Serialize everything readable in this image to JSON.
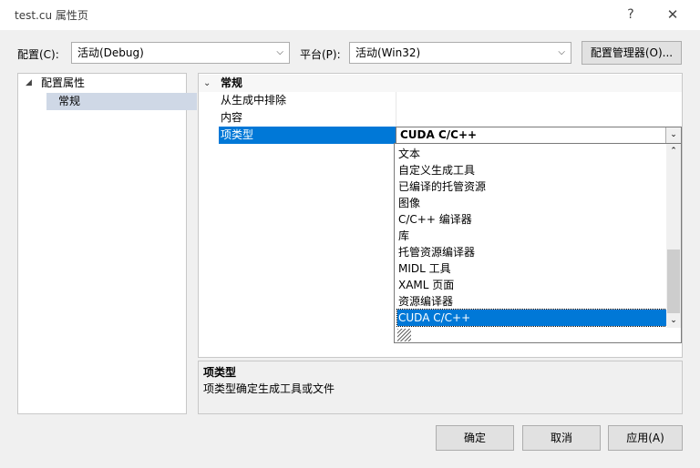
{
  "window": {
    "title": "test.cu 属性页",
    "help_glyph": "?",
    "close_glyph": "✕"
  },
  "toolbar": {
    "config_label": "配置(C):",
    "config_value": "活动(Debug)",
    "platform_label": "平台(P):",
    "platform_value": "活动(Win32)",
    "config_manager_label": "配置管理器(O)..."
  },
  "tree": {
    "root": {
      "label": "配置属性",
      "expanded": true
    },
    "children": [
      {
        "label": "常规",
        "selected": true
      }
    ]
  },
  "grid": {
    "category": "常规",
    "rows": [
      {
        "name": "从生成中排除",
        "value": ""
      },
      {
        "name": "内容",
        "value": ""
      },
      {
        "name": "项类型",
        "value": "CUDA C/C++",
        "selected": true
      }
    ]
  },
  "dropdown": {
    "items": [
      "文本",
      "自定义生成工具",
      "已编译的托管资源",
      "图像",
      "C/C++ 编译器",
      "库",
      "托管资源编译器",
      "MIDL 工具",
      "XAML 页面",
      "资源编译器",
      "CUDA C/C++"
    ],
    "selected_index": 10,
    "scroll_fraction": 1.0
  },
  "description": {
    "title": "项类型",
    "text": "项类型确定生成工具或文件"
  },
  "buttons": {
    "ok": "确定",
    "cancel": "取消",
    "apply": "应用(A)"
  },
  "colors": {
    "selection": "#0078d7",
    "tree_selection": "#cfd8e6",
    "window_bg": "#f0f0f0"
  }
}
